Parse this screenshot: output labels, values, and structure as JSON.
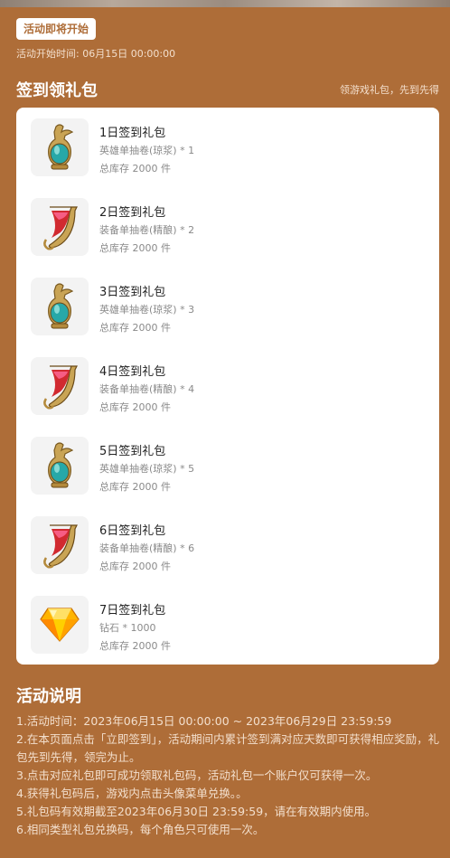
{
  "header": {
    "status_badge": "活动即将开始",
    "start_time": "活动开始时间: 06月15日 00:00:00"
  },
  "signin_section": {
    "title": "签到领礼包",
    "subtitle": "领游戏礼包，先到先得"
  },
  "gifts": [
    {
      "title": "1日签到礼包",
      "content": "英雄单抽卷(琼浆) * 1",
      "stock": "总库存 2000 件",
      "icon": "jade-vase-icon"
    },
    {
      "title": "2日签到礼包",
      "content": "装备单抽卷(精酿) * 2",
      "stock": "总库存 2000 件",
      "icon": "horn-cup-icon"
    },
    {
      "title": "3日签到礼包",
      "content": "英雄单抽卷(琼浆) * 3",
      "stock": "总库存 2000 件",
      "icon": "jade-vase-icon"
    },
    {
      "title": "4日签到礼包",
      "content": "装备单抽卷(精酿) * 4",
      "stock": "总库存 2000 件",
      "icon": "horn-cup-icon"
    },
    {
      "title": "5日签到礼包",
      "content": "英雄单抽卷(琼浆) * 5",
      "stock": "总库存 2000 件",
      "icon": "jade-vase-icon"
    },
    {
      "title": "6日签到礼包",
      "content": "装备单抽卷(精酿) * 6",
      "stock": "总库存 2000 件",
      "icon": "horn-cup-icon"
    },
    {
      "title": "7日签到礼包",
      "content": "钻石 * 1000",
      "stock": "总库存 2000 件",
      "icon": "diamond-icon"
    }
  ],
  "rules": {
    "title": "活动说明",
    "items": [
      "1.活动时间：2023年06月15日 00:00:00 ~ 2023年06月29日 23:59:59",
      "2.在本页面点击「立即签到」，活动期间内累计签到满对应天数即可获得相应奖励，礼包先到先得，领完为止。",
      "3.点击对应礼包即可成功领取礼包码，活动礼包一个账户仅可获得一次。",
      "4.获得礼包码后，游戏内点击头像菜单兑换。。",
      "5.礼包码有效期截至2023年06月30日 23:59:59，请在有效期内使用。",
      "6.相同类型礼包兑换码，每个角色只可使用一次。"
    ]
  },
  "colors": {
    "background": "#ae6d38",
    "card": "#ffffff",
    "muted_text": "#f3dfcd"
  }
}
